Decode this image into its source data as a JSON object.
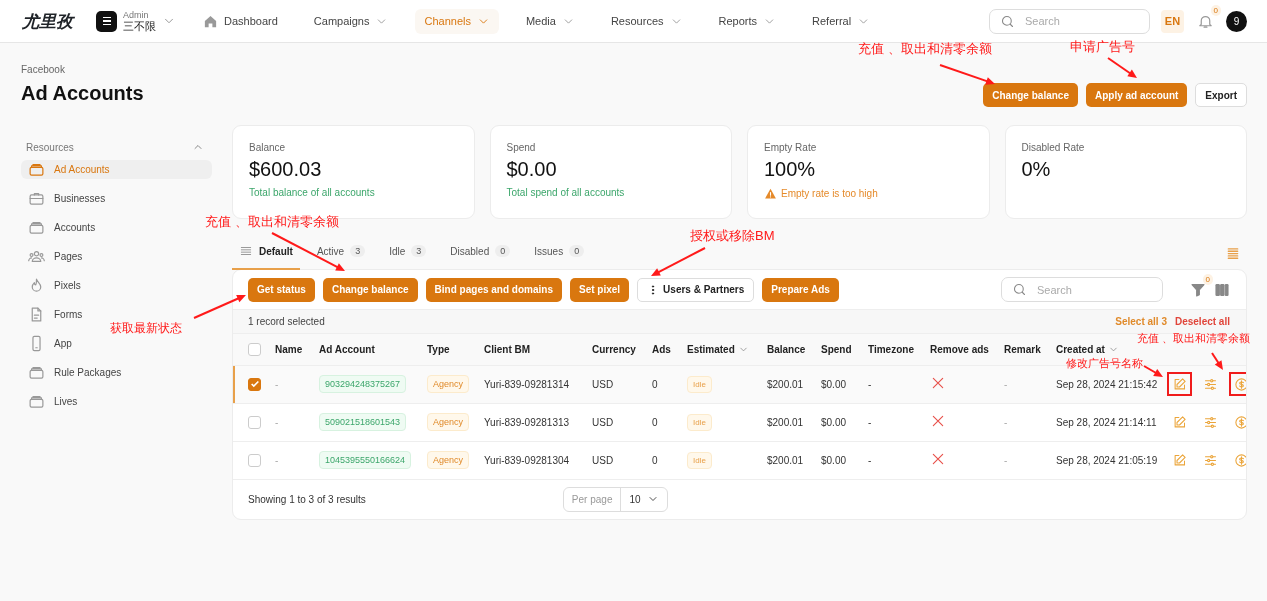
{
  "topbar": {
    "logo": "尤里孜",
    "account": {
      "role": "Admin",
      "name": "三不限"
    },
    "nav": [
      {
        "label": "Dashboard",
        "dropdown": false,
        "selected": false
      },
      {
        "label": "Campaigns",
        "dropdown": true,
        "selected": false
      },
      {
        "label": "Channels",
        "dropdown": true,
        "selected": true
      },
      {
        "label": "Media",
        "dropdown": true,
        "selected": false
      },
      {
        "label": "Resources",
        "dropdown": true,
        "selected": false
      },
      {
        "label": "Reports",
        "dropdown": true,
        "selected": false
      },
      {
        "label": "Referral",
        "dropdown": true,
        "selected": false
      }
    ],
    "search": {
      "placeholder": "Search"
    },
    "language": "EN",
    "notifications": "0",
    "avatar": "9"
  },
  "breadcrumb": "Facebook",
  "title": "Ad Accounts",
  "header_buttons": [
    {
      "label": "Change balance",
      "kind": "primary"
    },
    {
      "label": "Apply ad account",
      "kind": "primary"
    },
    {
      "label": "Export",
      "kind": "secondary"
    }
  ],
  "sidebar": {
    "heading": "Resources",
    "expanded": true,
    "items": [
      {
        "label": "Ad Accounts",
        "selected": true
      },
      {
        "label": "Businesses",
        "selected": false
      },
      {
        "label": "Accounts",
        "selected": false
      },
      {
        "label": "Pages",
        "selected": false
      },
      {
        "label": "Pixels",
        "selected": false
      },
      {
        "label": "Forms",
        "selected": false
      },
      {
        "label": "App",
        "selected": false
      },
      {
        "label": "Rule Packages",
        "selected": false
      },
      {
        "label": "Lives",
        "selected": false
      }
    ]
  },
  "stats": [
    {
      "label": "Balance",
      "value": "$600.03",
      "note": "Total balance of all accounts",
      "kind": "info"
    },
    {
      "label": "Spend",
      "value": "$0.00",
      "note": "Total spend of all accounts",
      "kind": "info"
    },
    {
      "label": "Empty Rate",
      "value": "100%",
      "note": "Empty rate is too high",
      "kind": "warning"
    },
    {
      "label": "Disabled Rate",
      "value": "0%"
    }
  ],
  "tabs": [
    {
      "label": "Default",
      "selected": true
    },
    {
      "label": "Active",
      "count": "3",
      "selected": false
    },
    {
      "label": "Idle",
      "count": "3",
      "selected": false
    },
    {
      "label": "Disabled",
      "count": "0",
      "selected": false
    },
    {
      "label": "Issues",
      "count": "0",
      "selected": false
    }
  ],
  "toolbar": {
    "buttons": [
      {
        "label": "Get status",
        "kind": "primary"
      },
      {
        "label": "Change balance",
        "kind": "primary"
      },
      {
        "label": "Bind pages and domains",
        "kind": "primary"
      },
      {
        "label": "Set pixel",
        "kind": "primary"
      },
      {
        "label": "Users & Partners",
        "kind": "menu"
      },
      {
        "label": "Prepare Ads",
        "kind": "primary"
      }
    ],
    "search": {
      "placeholder": "Search"
    },
    "filter_count": "0"
  },
  "selection": {
    "text": "1 record selected",
    "select_all": "Select all 3",
    "deselect_all": "Deselect all"
  },
  "table": {
    "all_checked": false,
    "columns": [
      {
        "label": "Name",
        "sortable": false
      },
      {
        "label": "Ad Account",
        "sortable": false
      },
      {
        "label": "Type",
        "sortable": false
      },
      {
        "label": "Client BM",
        "sortable": false
      },
      {
        "label": "Currency",
        "sortable": false
      },
      {
        "label": "Ads",
        "sortable": false
      },
      {
        "label": "Estimated",
        "sortable": true
      },
      {
        "label": "Balance",
        "sortable": false
      },
      {
        "label": "Spend",
        "sortable": false
      },
      {
        "label": "Timezone",
        "sortable": false
      },
      {
        "label": "Remove ads",
        "sortable": false
      },
      {
        "label": "Remark",
        "sortable": false
      },
      {
        "label": "Created at",
        "sortable": true
      }
    ],
    "rows": [
      {
        "selected": true,
        "name": "-",
        "ad_account": "903294248375267",
        "type": "Agency",
        "client_bm": "Yuri-839-09281314",
        "currency": "USD",
        "ads": "0",
        "estimated": "Idle",
        "balance": "$200.01",
        "spend": "$0.00",
        "timezone": "-",
        "remove_ads": false,
        "remark": "-",
        "created_at": "Sep 28, 2024 21:15:42",
        "actions": [
          {
            "kind": "edit",
            "highlighted": true
          },
          {
            "kind": "adjust",
            "highlighted": false
          },
          {
            "kind": "dollar",
            "highlighted": true
          }
        ]
      },
      {
        "selected": false,
        "name": "-",
        "ad_account": "509021518601543",
        "type": "Agency",
        "client_bm": "Yuri-839-09281313",
        "currency": "USD",
        "ads": "0",
        "estimated": "Idle",
        "balance": "$200.01",
        "spend": "$0.00",
        "timezone": "-",
        "remove_ads": false,
        "remark": "-",
        "created_at": "Sep 28, 2024 21:14:11",
        "actions": [
          {
            "kind": "edit",
            "highlighted": false
          },
          {
            "kind": "adjust",
            "highlighted": false
          },
          {
            "kind": "dollar",
            "highlighted": false
          }
        ]
      },
      {
        "selected": false,
        "name": "-",
        "ad_account": "1045395550166624",
        "type": "Agency",
        "client_bm": "Yuri-839-09281304",
        "currency": "USD",
        "ads": "0",
        "estimated": "Idle",
        "balance": "$200.01",
        "spend": "$0.00",
        "timezone": "-",
        "remove_ads": false,
        "remark": "-",
        "created_at": "Sep 28, 2024 21:05:19",
        "actions": [
          {
            "kind": "edit",
            "highlighted": false
          },
          {
            "kind": "adjust",
            "highlighted": false
          },
          {
            "kind": "dollar",
            "highlighted": false
          }
        ]
      }
    ]
  },
  "pagination": {
    "summary": "Showing 1 to 3 of 3 results",
    "per_page_label": "Per page",
    "per_page": "10"
  },
  "annotations": [
    {
      "text": "充值 、取出和清零余额"
    },
    {
      "text": "申请广告号"
    },
    {
      "text": "充值 、取出和清零余额"
    },
    {
      "text": "授权或移除BM"
    },
    {
      "text": "获取最新状态"
    },
    {
      "text": "修改广告号名称"
    },
    {
      "text": "充值 、取出和清零余额"
    }
  ]
}
